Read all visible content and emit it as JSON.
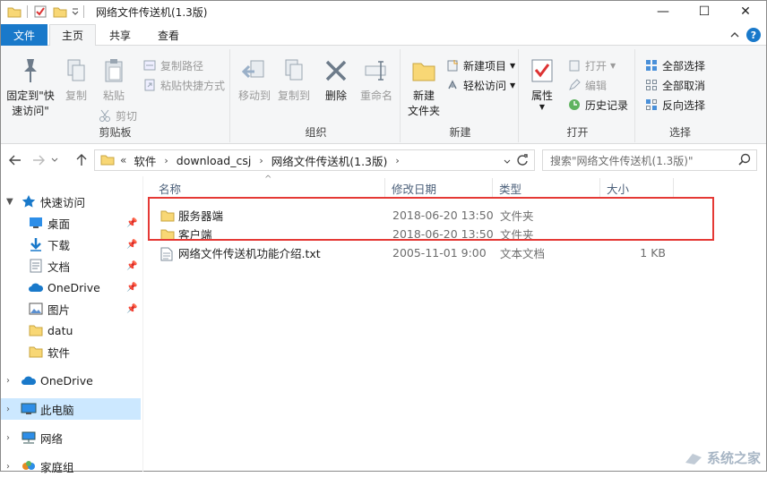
{
  "window": {
    "title": "网络文件传送机(1.3版)"
  },
  "winctl": {
    "minimize": "—",
    "maximize": "☐",
    "close": "✕"
  },
  "tabs": {
    "file": "文件",
    "home": "主页",
    "share": "共享",
    "view": "查看"
  },
  "ribbon": {
    "clipboard": {
      "label": "剪贴板",
      "pin": "固定到\"快\n速访问\"",
      "pin_line1": "固定到\"快",
      "pin_line2": "速访问\"",
      "copy": "复制",
      "paste": "粘贴",
      "copy_path": "复制路径",
      "paste_shortcut": "粘贴快捷方式",
      "cut": "剪切"
    },
    "organize": {
      "label": "组织",
      "move_to": "移动到",
      "copy_to": "复制到",
      "delete": "删除",
      "rename": "重命名"
    },
    "new": {
      "label": "新建",
      "new_folder_line1": "新建",
      "new_folder_line2": "文件夹",
      "new_item": "新建项目",
      "easy_access": "轻松访问"
    },
    "open": {
      "label": "打开",
      "properties": "属性",
      "open": "打开",
      "edit": "编辑",
      "history": "历史记录"
    },
    "select": {
      "label": "选择",
      "select_all": "全部选择",
      "select_none": "全部取消",
      "invert": "反向选择"
    }
  },
  "address": {
    "overflow": "«",
    "crumbs": [
      "软件",
      "download_csj",
      "网络文件传送机(1.3版)"
    ]
  },
  "search": {
    "placeholder": "搜索\"网络文件传送机(1.3版)\""
  },
  "navpane": {
    "quick_access": "快速访问",
    "desktop": "桌面",
    "downloads": "下载",
    "documents": "文档",
    "onedrive_qa": "OneDrive",
    "pictures": "图片",
    "datu": "datu",
    "software": "软件",
    "onedrive": "OneDrive",
    "this_pc": "此电脑",
    "network": "网络",
    "homegroup": "家庭组"
  },
  "columns": {
    "name": "名称",
    "date": "修改日期",
    "type": "类型",
    "size": "大小"
  },
  "files": [
    {
      "name": "服务器端",
      "date": "2018-06-20 13:50",
      "type": "文件夹",
      "size": "",
      "kind": "folder"
    },
    {
      "name": "客户端",
      "date": "2018-06-20 13:50",
      "type": "文件夹",
      "size": "",
      "kind": "folder"
    },
    {
      "name": "网络文件传送机功能介绍.txt",
      "date": "2005-11-01 9:00",
      "type": "文本文档",
      "size": "1 KB",
      "kind": "txt"
    }
  ],
  "watermark": {
    "text": "系统之家"
  },
  "colors": {
    "accent": "#1979ca",
    "folder": "#f8d775",
    "highlight": "#e53935",
    "selected_nav": "#cce8ff"
  }
}
